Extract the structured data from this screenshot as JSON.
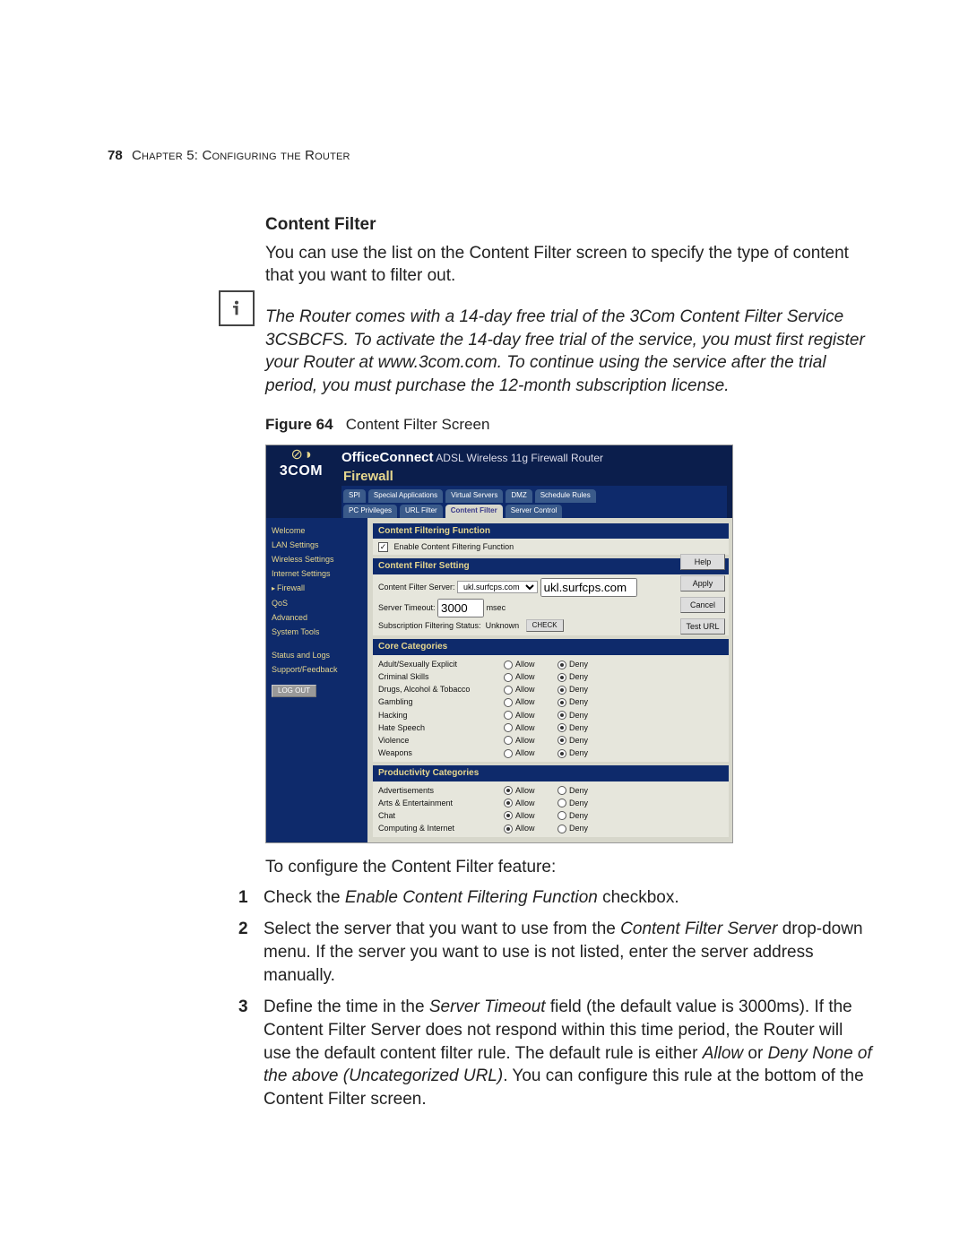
{
  "page_number": "78",
  "chapter_title": "Chapter 5: Configuring the Router",
  "heading": "Content Filter",
  "intro_para": "You can use the list on the Content Filter screen to specify the type of content that you want to filter out.",
  "note_para": "The Router comes with a 14-day free trial of the 3Com Content Filter Service 3CSBCFS. To activate the 14-day free trial of the service, you must first register your Router at www.3com.com. To continue using the service after the trial period, you must purchase the 12-month subscription license.",
  "figure": {
    "label": "Figure 64",
    "caption": "Content Filter Screen"
  },
  "screenshot": {
    "brand": "3COM",
    "product_a": "OfficeConnect",
    "product_b": "ADSL Wireless 11g Firewall Router",
    "section": "Firewall",
    "tabs_row1": [
      "SPI",
      "Special Applications",
      "Virtual Servers",
      "DMZ",
      "Schedule Rules"
    ],
    "tabs_row2": [
      "PC Privileges",
      "URL Filter",
      "Content Filter",
      "Server Control"
    ],
    "active_tab": "Content Filter",
    "nav": [
      "Welcome",
      "LAN Settings",
      "Wireless Settings",
      "Internet Settings",
      "Firewall",
      "QoS",
      "Advanced",
      "System Tools",
      "Status and Logs",
      "Support/Feedback"
    ],
    "nav_selected": "Firewall",
    "logout": "LOG OUT",
    "buttons": [
      "Help",
      "Apply",
      "Cancel",
      "Test URL"
    ],
    "section1": {
      "title": "Content Filtering Function",
      "checkbox_label": "Enable Content Filtering Function",
      "checkbox_checked": true
    },
    "section2": {
      "title": "Content Filter Setting",
      "server_label": "Content Filter Server:",
      "server_select": "ukl.surfcps.com",
      "server_text": "ukl.surfcps.com",
      "timeout_label": "Server Timeout:",
      "timeout_value": "3000",
      "timeout_unit": "msec",
      "status_label": "Subscription Filtering Status:",
      "status_value": "Unknown",
      "check_button": "CHECK"
    },
    "core": {
      "title": "Core Categories",
      "col_allow": "Allow",
      "col_deny": "Deny",
      "rows": [
        {
          "label": "Adult/Sexually Explicit",
          "choice": "deny"
        },
        {
          "label": "Criminal Skills",
          "choice": "deny"
        },
        {
          "label": "Drugs, Alcohol & Tobacco",
          "choice": "deny"
        },
        {
          "label": "Gambling",
          "choice": "deny"
        },
        {
          "label": "Hacking",
          "choice": "deny"
        },
        {
          "label": "Hate Speech",
          "choice": "deny"
        },
        {
          "label": "Violence",
          "choice": "deny"
        },
        {
          "label": "Weapons",
          "choice": "deny"
        }
      ]
    },
    "prod": {
      "title": "Productivity Categories",
      "rows": [
        {
          "label": "Advertisements",
          "choice": "allow"
        },
        {
          "label": "Arts & Entertainment",
          "choice": "allow"
        },
        {
          "label": "Chat",
          "choice": "allow"
        },
        {
          "label": "Computing & Internet",
          "choice": "allow"
        }
      ]
    }
  },
  "steps_intro": "To configure the Content Filter feature:",
  "steps": [
    {
      "num": "1",
      "prefix": "Check the ",
      "em": "Enable Content Filtering Function",
      "suffix": " checkbox."
    },
    {
      "num": "2",
      "prefix": "Select the server that you want to use from the ",
      "em": "Content Filter Server",
      "suffix": " drop-down menu. If the server you want to use is not listed, enter the server address manually."
    },
    {
      "num": "3",
      "prefix": "Define the time in the ",
      "em": "Server Timeout",
      "mid": " field (the default value is 3000ms). If the Content Filter Server does not respond within this time period, the Router will use the default content filter rule. The default rule is either ",
      "em2": "Allow",
      "mid2": " or ",
      "em3": "Deny None of the above (Uncategorized URL)",
      "suffix": ". You can configure this rule at the bottom of the Content Filter screen."
    }
  ]
}
